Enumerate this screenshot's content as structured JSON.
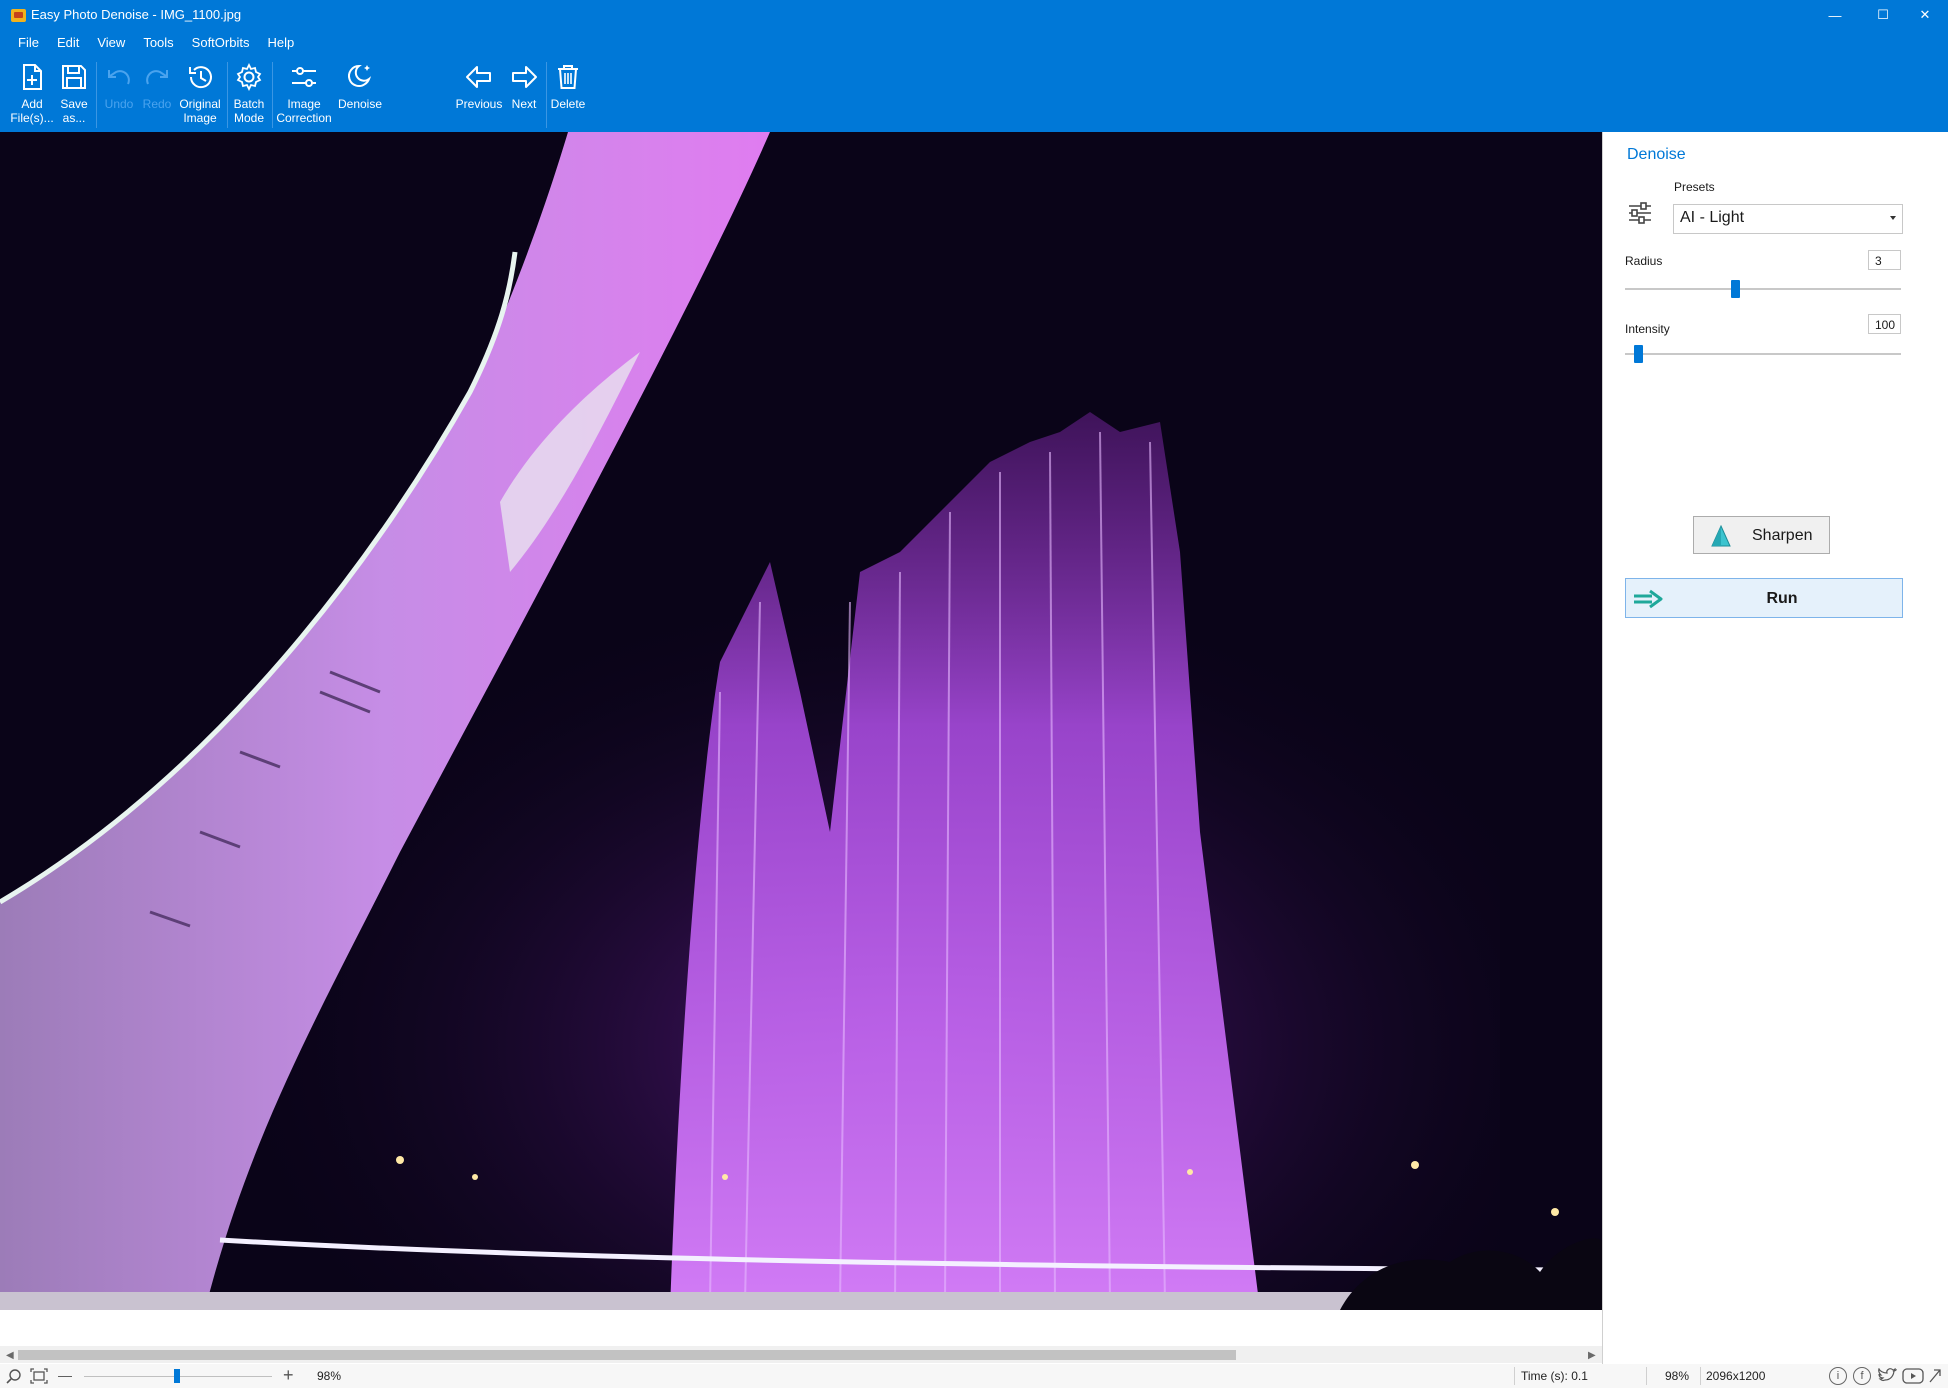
{
  "window": {
    "title": "Easy Photo Denoise - IMG_1100.jpg",
    "minimize_glyph": "—",
    "maximize_glyph": "☐",
    "close_glyph": "✕"
  },
  "menu": [
    "File",
    "Edit",
    "View",
    "Tools",
    "SoftOrbits",
    "Help"
  ],
  "toolbar": {
    "add_files": [
      "Add",
      "File(s)..."
    ],
    "save_as": [
      "Save",
      "as..."
    ],
    "undo": "Undo",
    "redo": "Redo",
    "original_image": [
      "Original",
      "Image"
    ],
    "batch_mode": [
      "Batch",
      "Mode"
    ],
    "image_correction": [
      "Image",
      "Correction"
    ],
    "denoise": "Denoise",
    "previous": "Previous",
    "next": "Next",
    "delete": "Delete"
  },
  "panel": {
    "title": "Denoise",
    "presets_label": "Presets",
    "presets_value": "AI - Light",
    "radius_label": "Radius",
    "radius_value": "3",
    "intensity_label": "Intensity",
    "intensity_value": "100",
    "sharpen_label": "Sharpen",
    "run_label": "Run"
  },
  "status": {
    "zoom_minus": "—",
    "zoom_plus": "+",
    "zoom_value": "98%",
    "time_label": "Time (s): 0.1",
    "zoom_percent": "98%",
    "dimensions": "2096x1200"
  },
  "colors": {
    "accent": "#0078d7",
    "fountain": "#b64cf0",
    "background_night": "#0a0418"
  }
}
